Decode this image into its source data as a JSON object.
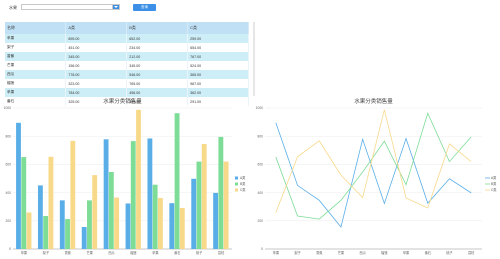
{
  "toolbar": {
    "field_label": "水果",
    "select_value": "",
    "button_label": "查询"
  },
  "table": {
    "headers": [
      "名称",
      "A类",
      "B类",
      "C类"
    ],
    "rows": [
      [
        "苹果",
        "895.00",
        "652.00",
        "259.00"
      ],
      [
        "梨子",
        "451.00",
        "234.00",
        "654.00"
      ],
      [
        "香蕉",
        "345.00",
        "212.00",
        "767.00"
      ],
      [
        "芒果",
        "156.00",
        "345.00",
        "524.00"
      ],
      [
        "西瓜",
        "778.00",
        "546.00",
        "365.00"
      ],
      [
        "榴莲",
        "323.00",
        "765.00",
        "987.00"
      ],
      [
        "苹果",
        "784.00",
        "456.00",
        "362.00"
      ],
      [
        "番石",
        "325.00",
        "963.00",
        "291.00"
      ]
    ]
  },
  "chart_data": [
    {
      "type": "bar",
      "title": "水果分类销售量",
      "categories": [
        "苹果",
        "梨子",
        "香蕉",
        "芒果",
        "西瓜",
        "榴莲",
        "苹果",
        "番石",
        "桃子",
        "荔枝"
      ],
      "series": [
        {
          "name": "A类",
          "color": "#5aaee8",
          "values": [
            895,
            451,
            345,
            156,
            778,
            323,
            784,
            325,
            498,
            398
          ]
        },
        {
          "name": "B类",
          "color": "#7ddc96",
          "values": [
            652,
            234,
            212,
            345,
            546,
            765,
            456,
            963,
            620,
            795
          ]
        },
        {
          "name": "C类",
          "color": "#f8d98a",
          "values": [
            259,
            654,
            767,
            524,
            365,
            987,
            362,
            291,
            745,
            620
          ]
        }
      ],
      "ylim": [
        0,
        1000
      ],
      "yticks": [
        0,
        200,
        400,
        600,
        800,
        1000
      ],
      "legend": "right"
    },
    {
      "type": "line",
      "title": "水果分类销售量",
      "categories": [
        "苹果",
        "梨子",
        "香蕉",
        "芒果",
        "西瓜",
        "榴莲",
        "苹果",
        "番石",
        "桃子",
        "荔枝"
      ],
      "series": [
        {
          "name": "A类",
          "color": "#5aaee8",
          "values": [
            895,
            451,
            345,
            156,
            778,
            323,
            784,
            325,
            498,
            398
          ]
        },
        {
          "name": "B类",
          "color": "#7ddc96",
          "values": [
            652,
            234,
            212,
            345,
            546,
            765,
            456,
            963,
            620,
            795
          ]
        },
        {
          "name": "C类",
          "color": "#f8d98a",
          "values": [
            259,
            654,
            767,
            524,
            365,
            987,
            362,
            291,
            745,
            620
          ]
        }
      ],
      "ylim": [
        0,
        1000
      ],
      "yticks": [
        0,
        200,
        400,
        600,
        800,
        1000
      ],
      "legend": "right"
    }
  ]
}
